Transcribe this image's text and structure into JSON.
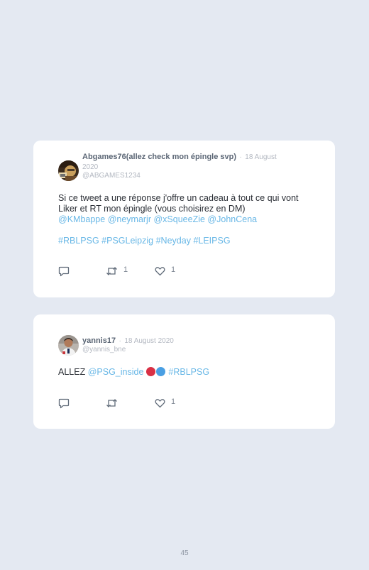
{
  "tweets": [
    {
      "author": "Abgames76(allez check mon épingle svp)",
      "separator": "·",
      "date": "18 August 2020",
      "handle": "@ABGAMES1234",
      "text_1": "Si ce tweet a une réponse j'offre un cadeau à tout ce qui vont Liker et RT mon épingle (vous choisirez en DM)",
      "mentions": [
        "@KMbappe",
        "@neymarjr",
        "@xSqueeZie",
        "@JohnCena"
      ],
      "hashtags": [
        "#RBLPSG",
        "#PSGLeipzig",
        "#Neyday",
        "#LEIPSG"
      ],
      "retweets": "1",
      "likes": "1"
    },
    {
      "author": "yannis17",
      "separator": "·",
      "date": "18 August 2020",
      "handle": "@yannis_bne",
      "text_1": "ALLEZ",
      "mention": "@PSG_inside",
      "emojis": [
        "red-circle-emoji",
        "blue-circle-emoji"
      ],
      "hashtag": "#RBLPSG",
      "likes": "1"
    }
  ],
  "icons": {
    "reply": "reply-icon",
    "retweet": "retweet-icon",
    "like": "heart-icon"
  },
  "colors": {
    "background": "#e4e9f2",
    "card": "#ffffff",
    "link": "#68b7e6",
    "author": "#5b6675",
    "muted": "#b3b8c1"
  },
  "page_number": "45"
}
